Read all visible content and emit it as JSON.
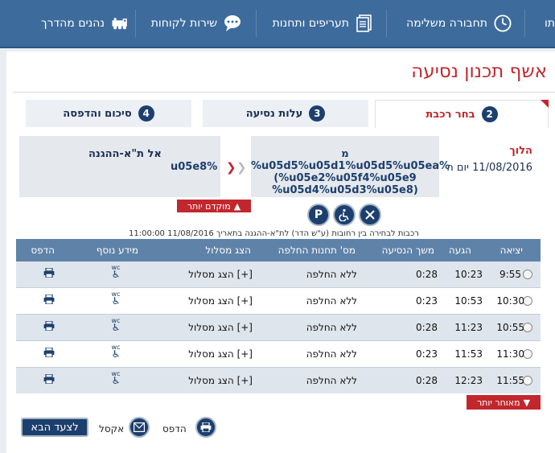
{
  "nav": {
    "items": [
      {
        "label": "נהנים מהדרך",
        "icon": "train-icon"
      },
      {
        "label": "שירות לקוחות",
        "icon": "chat-icon"
      },
      {
        "label": "תעריפים ותחנות",
        "icon": "document-icon"
      },
      {
        "label": "תחבורה משלימה",
        "icon": "clock-icon"
      },
      {
        "label": "תו"
      }
    ]
  },
  "page": {
    "title": "אשף תכנון נסיעה"
  },
  "steps": [
    {
      "num": "2",
      "label": "בחר רכבת"
    },
    {
      "num": "3",
      "label": "עלות נסיעה"
    },
    {
      "num": "4",
      "label": "סיכום והדפסה"
    }
  ],
  "route": {
    "going_label": "הלוך",
    "date": "11/08/2016 יום ה",
    "middle_line1": "מ",
    "middle_line2": "%u05d5%u05d1%u05d5%u05ea%",
    "middle_line3": "(%u05e2%u05f4%u05e9",
    "middle_line4": "%u05d4%u05d3%u05e8)",
    "destination": "אל ת\"א-ההגנה",
    "destination_code": "u05e8%"
  },
  "controls": {
    "earlier_label": "מוקדם יותר",
    "later_label": "מאוחר יותר",
    "filters": [
      "fork-knife-icon",
      "wheelchair-icon",
      "parking-icon"
    ],
    "note": "רכבות לבחירה בין רחובות (ע\"ש הדר) לת\"א-ההגנה בתאריך 11/08/2016 11:00:00"
  },
  "table": {
    "headers": {
      "departure": "יציאה",
      "arrival": "הגעה",
      "duration": "משך הנסיעה",
      "transfers": "מס' תחנות החלפה",
      "route": "הצג מסלול",
      "info": "מידע נוסף",
      "print": "הדפס"
    },
    "rows": [
      {
        "departure": "9:55",
        "arrival": "10:23",
        "duration": "0:28",
        "transfers": "ללא החלפה",
        "route_link": "[+] הצג מסלול"
      },
      {
        "departure": "10:30",
        "arrival": "10:53",
        "duration": "0:23",
        "transfers": "ללא החלפה",
        "route_link": "[+] הצג מסלול"
      },
      {
        "departure": "10:55",
        "arrival": "11:23",
        "duration": "0:28",
        "transfers": "ללא החלפה",
        "route_link": "[+] הצג מסלול"
      },
      {
        "departure": "11:30",
        "arrival": "11:53",
        "duration": "0:23",
        "transfers": "ללא החלפה",
        "route_link": "[+] הצג מסלול"
      },
      {
        "departure": "11:55",
        "arrival": "12:23",
        "duration": "0:28",
        "transfers": "ללא החלפה",
        "route_link": "[+] הצג מסלול"
      }
    ],
    "facility_wc": "wc"
  },
  "bottom": {
    "print_label": "הדפס",
    "excel_label": "אקסל",
    "next_label": "לצעד הבא"
  },
  "colors": {
    "nav": "#3d6b9c",
    "accent_red": "#c1272d",
    "navy": "#1c3f6e",
    "table_header": "#5f82a8",
    "row_shade": "#dfe5ec"
  }
}
